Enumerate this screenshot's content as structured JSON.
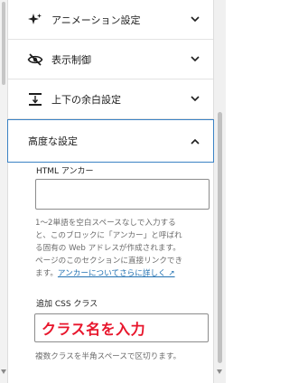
{
  "panels": {
    "animation": {
      "label": "アニメーション設定",
      "icon": "sparkle-icon"
    },
    "visibility": {
      "label": "表示制御",
      "icon": "eye-slash-icon"
    },
    "margin": {
      "label": "上下の余白設定",
      "icon": "vertical-spacing-icon"
    }
  },
  "advanced": {
    "label": "高度な設定",
    "html_anchor": {
      "label": "HTML アンカー",
      "value": "",
      "help_line1": "1〜2単語を空白スペースなしで入力する",
      "help_line2": "と、このブロックに「アンカー」と呼ばれ",
      "help_line3": "る固有の Web アドレスが作成されます。",
      "help_line4": "ページのこのセクションに直接リンクでき",
      "help_line5_prefix": "ます。",
      "help_link": "アンカーについてさらに詳しく ↗"
    },
    "css_class": {
      "label": "追加 CSS クラス",
      "value": "クラス名を入力",
      "help": "複数クラスを半角スペースで区切ります。"
    }
  },
  "colors": {
    "accent": "#3b82c4",
    "link": "#2271b1",
    "highlight_text": "#e8162c"
  }
}
